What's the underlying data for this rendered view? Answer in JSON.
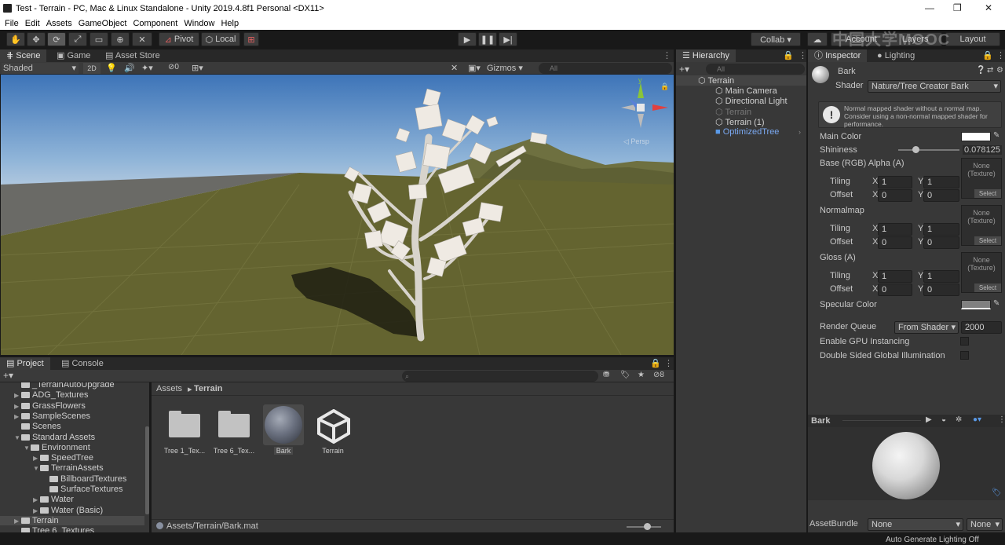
{
  "window": {
    "title": "Test - Terrain - PC, Mac & Linux Standalone - Unity 2019.4.8f1 Personal <DX11>",
    "minimize": "—",
    "maximize": "❐",
    "close": "✕"
  },
  "menu": [
    "File",
    "Edit",
    "Assets",
    "GameObject",
    "Component",
    "Window",
    "Help"
  ],
  "toolbar": {
    "pivot": "Pivot",
    "local": "Local",
    "collab": "Collab ▾",
    "account": "Account",
    "layers": "Layers",
    "layout": "Layout"
  },
  "watermark": "中国大学MOOC",
  "scene_tabs": [
    "Scene",
    "Game",
    "Asset Store"
  ],
  "scene_bar": {
    "shading": "Shaded",
    "mode2d": "2D",
    "hidden_count": "0",
    "gizmos": "Gizmos",
    "search_placeholder": "All"
  },
  "gizmo": {
    "persp": "◁ Persp",
    "y": "y"
  },
  "hierarchy": {
    "tab": "Hierarchy",
    "search_placeholder": "All",
    "root": "Terrain",
    "items": [
      "Main Camera",
      "Directional Light",
      "Terrain",
      "Terrain (1)",
      "OptimizedTree"
    ]
  },
  "inspector": {
    "tabs": [
      "Inspector",
      "Lighting"
    ],
    "material_name": "Bark",
    "shader_label": "Shader",
    "shader_value": "Nature/Tree Creator Bark",
    "warning": "Normal mapped shader without a normal map. Consider using a non-normal mapped shader for performance.",
    "main_color_label": "Main Color",
    "shininess_label": "Shininess",
    "shininess_value": "0.078125",
    "shininess_level": 0.078125,
    "base_label": "Base (RGB) Alpha (A)",
    "normal_label": "Normalmap",
    "gloss_label": "Gloss (A)",
    "tiling_label": "Tiling",
    "offset_label": "Offset",
    "x_label": "X",
    "y_label": "Y",
    "tiling_x": "1",
    "tiling_y": "1",
    "offset_x": "0",
    "offset_y": "0",
    "tex_none": "None\n(Texture)",
    "tex_select": "Select",
    "specular_label": "Specular Color",
    "render_queue_label": "Render Queue",
    "render_queue_mode": "From Shader",
    "render_queue_value": "2000",
    "gpu_label": "Enable GPU Instancing",
    "dsgi_label": "Double Sided Global Illumination",
    "preview_title": "Bark",
    "assetbundle_label": "AssetBundle",
    "assetbundle_value": "None",
    "assetbundle_variant": "None"
  },
  "project": {
    "tabs": [
      "Project",
      "Console"
    ],
    "tree": [
      {
        "label": "_TerrainAutoUpgrade",
        "indent": 1,
        "arrow": ""
      },
      {
        "label": "ADG_Textures",
        "indent": 1,
        "arrow": "▶"
      },
      {
        "label": "GrassFlowers",
        "indent": 1,
        "arrow": "▶"
      },
      {
        "label": "SampleScenes",
        "indent": 1,
        "arrow": "▶"
      },
      {
        "label": "Scenes",
        "indent": 1,
        "arrow": ""
      },
      {
        "label": "Standard Assets",
        "indent": 1,
        "arrow": "▼"
      },
      {
        "label": "Environment",
        "indent": 2,
        "arrow": "▼"
      },
      {
        "label": "SpeedTree",
        "indent": 3,
        "arrow": "▶"
      },
      {
        "label": "TerrainAssets",
        "indent": 3,
        "arrow": "▼"
      },
      {
        "label": "BillboardTextures",
        "indent": 4,
        "arrow": ""
      },
      {
        "label": "SurfaceTextures",
        "indent": 4,
        "arrow": ""
      },
      {
        "label": "Water",
        "indent": 3,
        "arrow": "▶"
      },
      {
        "label": "Water (Basic)",
        "indent": 3,
        "arrow": "▶"
      },
      {
        "label": "Terrain",
        "indent": 1,
        "arrow": "▶"
      },
      {
        "label": "Tree 6_Textures",
        "indent": 1,
        "arrow": ""
      }
    ],
    "breadcrumb_root": "Assets",
    "breadcrumb_sep": "▸",
    "breadcrumb_current": "Terrain",
    "badge_count": "8",
    "assets": [
      "Tree 1_Tex...",
      "Tree 6_Tex...",
      "Bark",
      "Terrain"
    ],
    "status_path": "Assets/Terrain/Bark.mat"
  },
  "statusbar": {
    "text": "Auto Generate Lighting Off"
  },
  "colors": {
    "accent_blue": "#3e7ce0",
    "panel_bg": "#383838",
    "dark_bg": "#191919",
    "ground": "#646430"
  }
}
